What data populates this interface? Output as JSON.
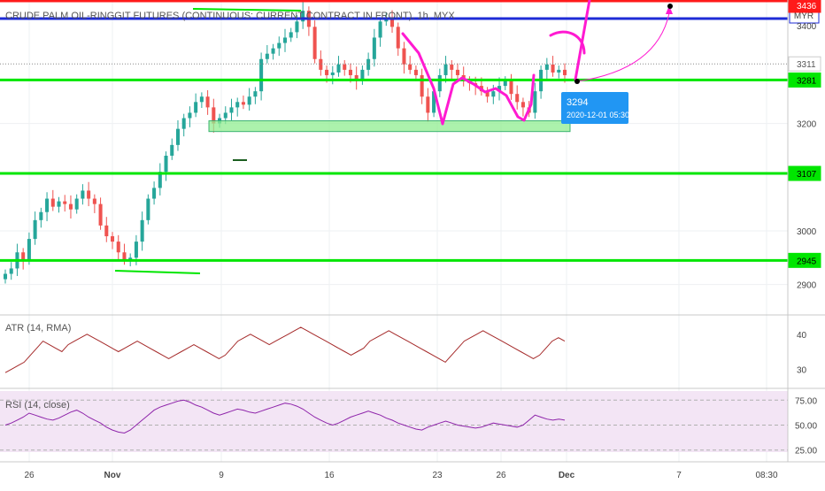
{
  "title": "CRUDE PALM OIL-RINGGIT FUTURES (CONTINUOUS: CURRENT CONTRACT IN FRONT), 1h, MYX",
  "currency": "MYR",
  "tooltip": {
    "price": "3294",
    "datetime": "2020-12-01 05:30"
  },
  "x_ticks": [
    "26",
    "Nov",
    "9",
    "16",
    "23",
    "26",
    "Dec",
    "7",
    "08:30"
  ],
  "price_ticks": [
    "2900",
    "3000",
    "3200"
  ],
  "price_top_label": "3400",
  "atr_ticks": [
    "40",
    "30"
  ],
  "rsi_ticks": [
    "75.00",
    "50.00",
    "25.00"
  ],
  "colors": {
    "up": "#26a69a",
    "down": "#ef5350",
    "green_line": "#00e600",
    "blue_line": "#1e2bd6",
    "red_line": "#ff1a1a",
    "magenta": "#ff1ad1",
    "atr_line": "#a52a2a",
    "rsi_line": "#8e24aa",
    "rsi_band": "#f3e5f5",
    "zone_fill": "#90ee90",
    "tooltip_bg": "#2196f3"
  },
  "chart_data": [
    {
      "type": "candlestick",
      "title": "CRUDE PALM OIL-RINGGIT FUTURES (CONTINUOUS: CURRENT CONTRACT IN FRONT), 1h, MYX",
      "ylim": [
        2850,
        3430
      ],
      "ticks": [
        2900,
        3000,
        3200
      ],
      "horizontal_levels": [
        {
          "label": "3281",
          "value": 3281,
          "color": "#00e600"
        },
        {
          "label": "3107",
          "value": 3107,
          "color": "#00e600"
        },
        {
          "label": "2945",
          "value": 2945,
          "color": "#00e600"
        },
        {
          "label": "3311",
          "value": 3311,
          "color": "#888888",
          "style": "dotted"
        },
        {
          "label": "3436",
          "value": 3436,
          "color": "#ff1a1a"
        }
      ],
      "support_zone": {
        "from": 3185,
        "to": 3205
      },
      "close_path": [
        2920,
        2930,
        2960,
        2945,
        2985,
        3020,
        3035,
        3060,
        3045,
        3055,
        3050,
        3040,
        3060,
        3075,
        3060,
        3050,
        3010,
        2990,
        2980,
        2960,
        2945,
        2950,
        2980,
        3020,
        3060,
        3080,
        3110,
        3140,
        3160,
        3190,
        3210,
        3220,
        3240,
        3250,
        3230,
        3200,
        3210,
        3220,
        3230,
        3240,
        3235,
        3250,
        3260,
        3320,
        3330,
        3340,
        3350,
        3360,
        3370,
        3390,
        3410,
        3380,
        3320,
        3300,
        3290,
        3295,
        3310,
        3300,
        3290,
        3280,
        3300,
        3320,
        3360,
        3390,
        3395,
        3380,
        3340,
        3310,
        3300,
        3290,
        3250,
        3220,
        3260,
        3290,
        3310,
        3300,
        3290,
        3280,
        3275,
        3270,
        3260,
        3250,
        3260,
        3270,
        3280,
        3255,
        3240,
        3230,
        3220,
        3260,
        3300,
        3310,
        3295,
        3300,
        3290
      ]
    },
    {
      "type": "line",
      "name": "ATR (14, RMA)",
      "ylim": [
        25,
        45
      ],
      "ticks": [
        40,
        30
      ],
      "values": [
        29,
        30,
        31,
        32,
        34,
        36,
        38,
        37,
        36,
        35,
        37,
        38,
        39,
        40,
        39,
        38,
        37,
        36,
        35,
        36,
        37,
        38,
        37,
        36,
        35,
        34,
        33,
        34,
        35,
        36,
        37,
        36,
        35,
        34,
        33,
        34,
        36,
        38,
        39,
        40,
        39,
        38,
        37,
        38,
        39,
        40,
        41,
        42,
        41,
        40,
        39,
        38,
        37,
        36,
        35,
        34,
        35,
        36,
        38,
        39,
        40,
        41,
        40,
        39,
        38,
        37,
        36,
        35,
        34,
        33,
        32,
        34,
        36,
        38,
        39,
        40,
        41,
        40,
        39,
        38,
        37,
        36,
        35,
        34,
        33,
        34,
        36,
        38,
        39,
        38
      ]
    },
    {
      "type": "line",
      "name": "RSI (14, close)",
      "ylim": [
        15,
        85
      ],
      "ticks": [
        75,
        50,
        25
      ],
      "values": [
        50,
        52,
        55,
        58,
        62,
        60,
        58,
        56,
        55,
        57,
        60,
        63,
        65,
        62,
        58,
        55,
        52,
        48,
        45,
        43,
        42,
        45,
        50,
        55,
        60,
        65,
        68,
        70,
        72,
        74,
        75,
        73,
        70,
        68,
        65,
        62,
        60,
        62,
        64,
        66,
        65,
        63,
        62,
        64,
        66,
        68,
        70,
        72,
        71,
        69,
        66,
        62,
        58,
        55,
        52,
        50,
        52,
        55,
        58,
        60,
        62,
        64,
        62,
        60,
        57,
        55,
        52,
        50,
        48,
        46,
        45,
        48,
        50,
        52,
        54,
        52,
        50,
        49,
        48,
        47,
        48,
        50,
        52,
        51,
        50,
        49,
        48,
        50,
        55,
        60,
        58,
        56,
        55,
        56,
        55
      ]
    }
  ]
}
